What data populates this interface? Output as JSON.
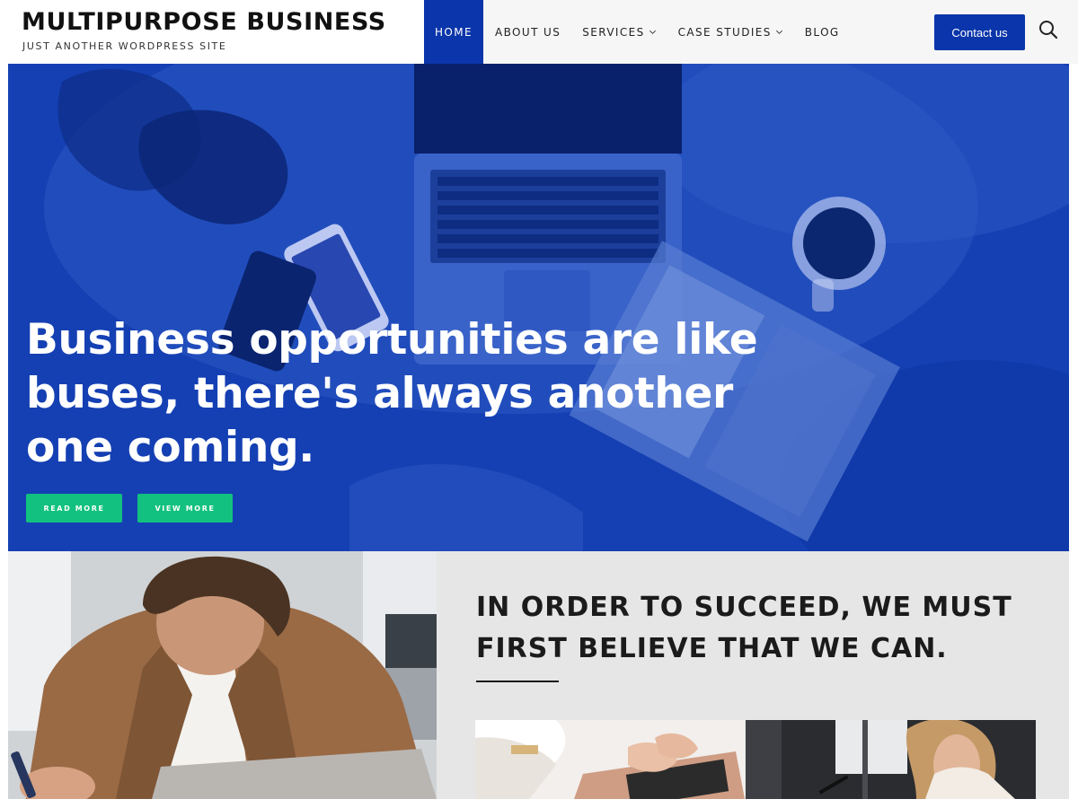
{
  "site": {
    "title": "MULTIPURPOSE BUSINESS",
    "tagline": "JUST ANOTHER WORDPRESS SITE"
  },
  "nav": {
    "items": [
      {
        "label": "HOME",
        "active": true,
        "has_dropdown": false
      },
      {
        "label": "ABOUT US",
        "active": false,
        "has_dropdown": false
      },
      {
        "label": "SERVICES",
        "active": false,
        "has_dropdown": true
      },
      {
        "label": "CASE STUDIES",
        "active": false,
        "has_dropdown": true
      },
      {
        "label": "BLOG",
        "active": false,
        "has_dropdown": false
      }
    ],
    "contact_label": "Contact us",
    "search_icon": "search-icon",
    "dropdown_icon": "chevron-down-icon"
  },
  "hero": {
    "title": "Business opportunities are like buses, there's always another one coming.",
    "read_more_label": "READ MORE",
    "view_more_label": "VIEW MORE"
  },
  "feature": {
    "quote": "IN ORDER TO SUCCEED, WE MUST FIRST BELIEVE THAT WE CAN."
  },
  "colors": {
    "brand_blue": "#0b35aa",
    "button_green": "#12c17f",
    "panel_gray": "#e6e6e6",
    "text_dark": "#111111"
  }
}
